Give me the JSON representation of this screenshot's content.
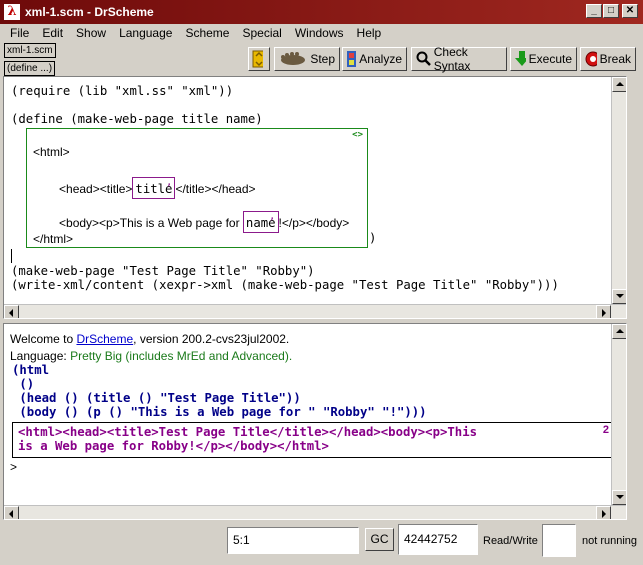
{
  "window": {
    "title": "xml-1.scm - DrScheme"
  },
  "menu": [
    "File",
    "Edit",
    "Show",
    "Language",
    "Scheme",
    "Special",
    "Windows",
    "Help"
  ],
  "toolbar": {
    "file_tab": "xml-1.scm",
    "define_menu": "(define ...)",
    "step": "Step",
    "analyze": "Analyze",
    "check_syntax": "Check Syntax",
    "execute": "Execute",
    "break": "Break"
  },
  "definitions": {
    "line1": "(require (lib \"xml.ss\" \"xml\"))",
    "line2": "(define (make-web-page title name)",
    "xml_box": {
      "html_open": "<html>",
      "head_pre": "<head><title>",
      "title_unquote": "title",
      "head_post": "</title></head>",
      "body_pre": "<body><p>This is a Web page for ",
      "name_unquote": "name",
      "body_post": "!</p></body>",
      "html_close": "</html>",
      "marker": "<>"
    },
    "close_paren": ")",
    "line3": "(make-web-page \"Test Page Title\" \"Robby\")",
    "line4": "(write-xml/content (xexpr->xml (make-web-page \"Test Page Title\" \"Robby\")))"
  },
  "interactions": {
    "welcome_prefix": "Welcome to ",
    "welcome_link": "DrScheme",
    "welcome_suffix": ", version 200.2-cvs23jul2002.",
    "language_prefix": "Language: ",
    "language_value": "Pretty Big (includes MrEd and Advanced).",
    "result_lines": [
      "(html",
      " ()",
      " (head () (title () \"Test Page Title\"))",
      " (body () (p () \"This is a Web page for \" \"Robby\" \"!\")))"
    ],
    "output_lines": [
      "<html><head><title>Test Page Title</title></head><body><p>This",
      "is a Web page for Robby!</p></body></html>"
    ],
    "output_marker": "2",
    "prompt": ">"
  },
  "status": {
    "position": "5:1",
    "gc_label": "GC",
    "memory": "42442752",
    "mode": "Read/Write",
    "running": "not running"
  },
  "colors": {
    "titlebar": "#a02820",
    "xml_box_border": "#1a8a1a",
    "unquote_border": "#8b1a8b",
    "result_text": "#000088",
    "output_text": "#880088",
    "language_text": "#1a7a1a"
  }
}
